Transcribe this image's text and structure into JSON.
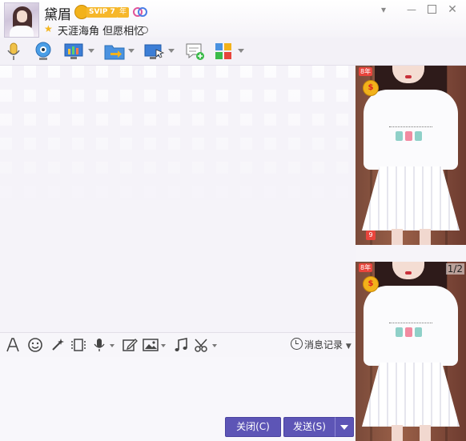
{
  "header": {
    "nickname": "黛眉",
    "svip_badge": "SVIP 7",
    "svip_year": "年",
    "signature": "天涯海角 但愿相忆",
    "window_controls": [
      "chevron-down-icon",
      "minimize-icon",
      "maximize-icon",
      "close-icon"
    ]
  },
  "toolbar": {
    "items": [
      "voice-call-icon",
      "video-call-icon",
      "screen-share-icon",
      "file-transfer-icon",
      "remote-desktop-icon",
      "message-app-icon",
      "apps-grid-icon"
    ]
  },
  "input_toolbar": {
    "items": [
      "font-icon",
      "emoji-icon",
      "magic-wand-icon",
      "screenshot-frame-icon",
      "voice-message-icon",
      "edit-icon",
      "image-icon",
      "music-icon",
      "scissors-icon"
    ],
    "history_label": "消息记录"
  },
  "buttons": {
    "close_label": "关闭(C)",
    "send_label": "发送(S)"
  },
  "side_panel": {
    "year_badge": "8年",
    "level_badge": "9",
    "page_indicator": "1/2"
  },
  "colors": {
    "accent": "#5d55b6",
    "background": "#f7f5fa",
    "svip": "#f6b72a"
  }
}
